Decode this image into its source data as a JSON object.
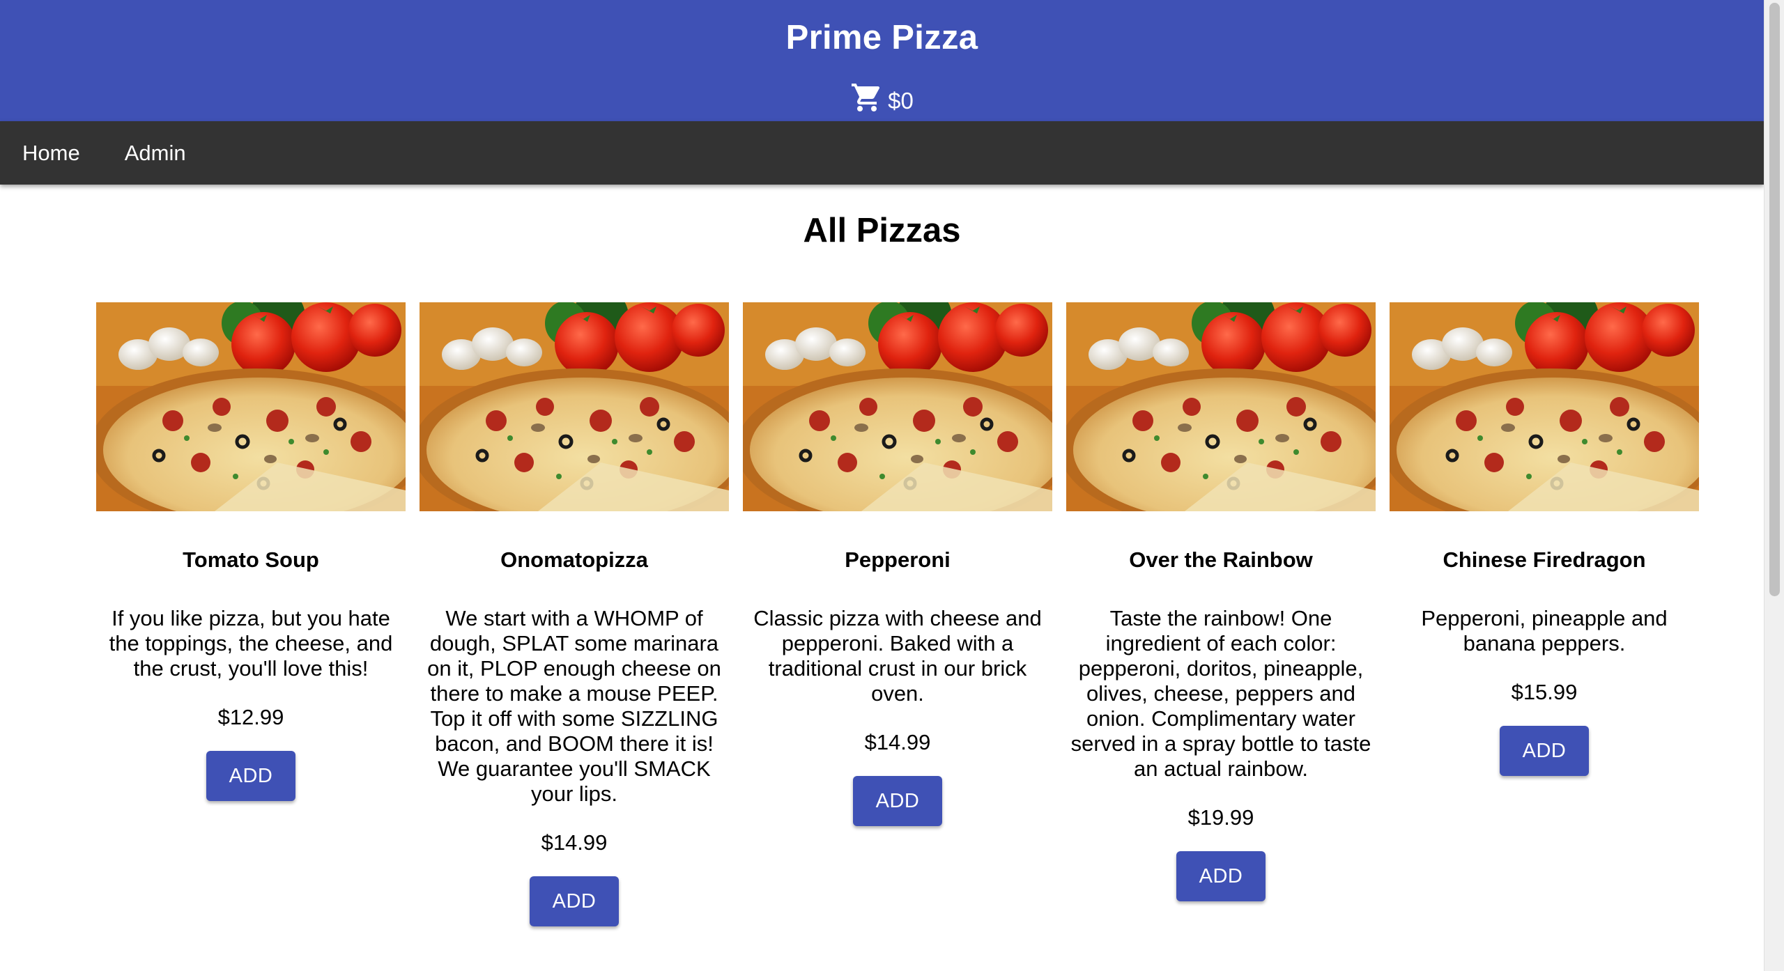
{
  "header": {
    "title": "Prime Pizza",
    "cart_total": "$0",
    "cart_icon": "shopping-cart-icon"
  },
  "nav": {
    "items": [
      {
        "label": "Home"
      },
      {
        "label": "Admin"
      }
    ]
  },
  "main": {
    "heading": "All Pizzas",
    "add_label": "ADD",
    "pizzas": [
      {
        "name": "Tomato Soup",
        "description": "If you like pizza, but you hate the toppings, the cheese, and the crust, you'll love this!",
        "price": "$12.99"
      },
      {
        "name": "Onomatopizza",
        "description": "We start with a WHOMP of dough, SPLAT some marinara on it, PLOP enough cheese on there to make a mouse PEEP. Top it off with some SIZZLING bacon, and BOOM there it is! We guarantee you'll SMACK your lips.",
        "price": "$14.99"
      },
      {
        "name": "Pepperoni",
        "description": "Classic pizza with cheese and pepperoni. Baked with a traditional crust in our brick oven.",
        "price": "$14.99"
      },
      {
        "name": "Over the Rainbow",
        "description": "Taste the rainbow! One ingredient of each color: pepperoni, doritos, pineapple, olives, cheese, peppers and onion. Complimentary water served in a spray bottle to taste an actual rainbow.",
        "price": "$19.99"
      },
      {
        "name": "Chinese Firedragon",
        "description": "Pepperoni, pineapple and banana peppers.",
        "price": "$15.99"
      }
    ]
  },
  "colors": {
    "primary": "#3f51b5",
    "navbar": "#333333"
  }
}
